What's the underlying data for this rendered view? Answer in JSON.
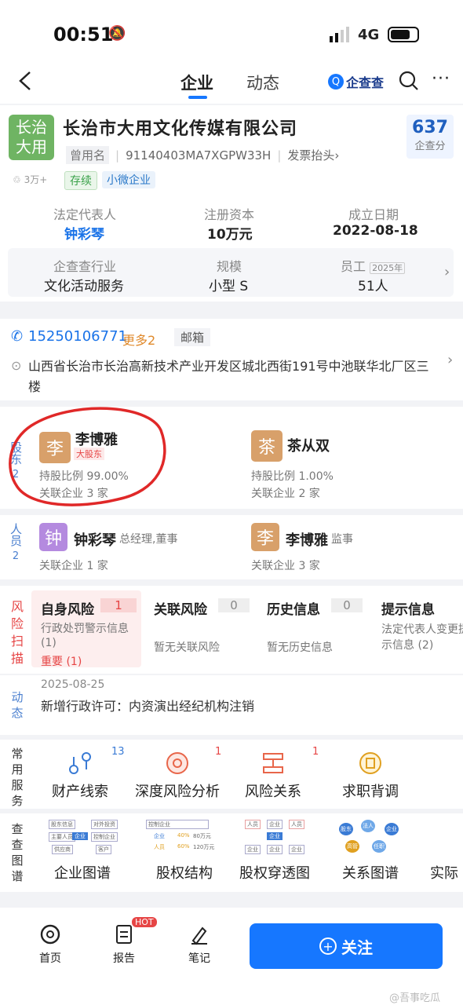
{
  "status": {
    "time": "00:51",
    "network": "4G"
  },
  "nav": {
    "tab_company": "企业",
    "tab_news": "动态",
    "brand": "企查查"
  },
  "company": {
    "logo_line1": "长治",
    "logo_line2": "大用",
    "name": "长治市大用文化传媒有限公司",
    "alias_label": "曾用名",
    "credit_code": "91140403MA7XGPW33H",
    "invoice": "发票抬头",
    "likes": "3万+",
    "tag_status": "存续",
    "tag_size": "小微企业",
    "score": "637",
    "score_label": "企查分"
  },
  "basic": {
    "legal_rep_label": "法定代表人",
    "legal_rep": "钟彩琴",
    "capital_label": "注册资本",
    "capital": "10万元",
    "founded_label": "成立日期",
    "founded": "2022-08-18"
  },
  "industry": {
    "industry_label": "企查查行业",
    "industry": "文化活动服务",
    "scale_label": "规模",
    "scale": "小型 S",
    "staff_label": "员工",
    "staff_year": "2025年",
    "staff": "51人"
  },
  "contact": {
    "phone": "15250106771",
    "more": "更多2",
    "email": "邮箱",
    "address": "山西省长治市长治高新技术产业开发区城北西街191号中池联华北厂区三楼"
  },
  "shareholders": {
    "title": "股东",
    "count": "2",
    "items": [
      {
        "initial": "李",
        "name": "李博雅",
        "badge": "大股东",
        "ratio": "持股比例 99.00%",
        "related": "关联企业 3 家",
        "color": "#d8a06a"
      },
      {
        "initial": "茶",
        "name": "茶从双",
        "ratio": "持股比例 1.00%",
        "related": "关联企业 2 家",
        "color": "#d8a06a"
      }
    ]
  },
  "staff_section": {
    "title": "人员",
    "count": "2",
    "items": [
      {
        "initial": "钟",
        "name": "钟彩琴",
        "role": "总经理,董事",
        "related": "关联企业 1 家",
        "color": "#b48adf"
      },
      {
        "initial": "李",
        "name": "李博雅",
        "role": "监事",
        "related": "关联企业 3 家",
        "color": "#d8a06a"
      }
    ]
  },
  "risk": {
    "title": "风险扫描",
    "cols": [
      {
        "name": "自身风险",
        "count": "1",
        "desc": "行政处罚警示信息 (1)",
        "extra": "重要 (1)"
      },
      {
        "name": "关联风险",
        "count": "0",
        "desc": "暂无关联风险"
      },
      {
        "name": "历史信息",
        "count": "0",
        "desc": "暂无历史信息"
      },
      {
        "name": "提示信息",
        "desc": "法定代表人变更提示信息 (2)"
      }
    ]
  },
  "news": {
    "title": "动态",
    "date": "2025-08-25",
    "text": "新增行政许可：内资演出经纪机构注销"
  },
  "services": {
    "title": "常用服务",
    "items": [
      {
        "label": "财产线索",
        "badge": "13",
        "icon": "property-clue-icon"
      },
      {
        "label": "深度风险分析",
        "badge": "1",
        "icon": "deep-risk-icon"
      },
      {
        "label": "风险关系",
        "badge": "1",
        "icon": "risk-relation-icon"
      },
      {
        "label": "求职背调",
        "icon": "job-check-icon"
      }
    ]
  },
  "graphs": {
    "title": "查查图谱",
    "items": [
      {
        "label": "企业图谱",
        "mini": [
          "股东信息",
          "对外投资",
          "主要人员",
          "企业",
          "控制企业",
          "供应商",
          "客户"
        ]
      },
      {
        "label": "股权结构",
        "mini": [
          "控制企业",
          "企业",
          "40%",
          "80万元",
          "人员",
          "60%",
          "120万元"
        ]
      },
      {
        "label": "股权穿透图",
        "mini": [
          "人员",
          "企业",
          "人员",
          "企业",
          "企业",
          "企业",
          "企业"
        ]
      },
      {
        "label": "关系图谱",
        "mini": [
          "股东",
          "法人",
          "企业",
          "高管",
          "任职"
        ]
      },
      {
        "label": "实际"
      }
    ]
  },
  "bottom": {
    "home": "首页",
    "report": "报告",
    "hot": "HOT",
    "notes": "笔记",
    "follow": "关注",
    "watermark": "@吾事吃瓜"
  },
  "colors": {
    "brand": "#1677ff",
    "risk": "#e64545",
    "green": "#3aa24a"
  }
}
